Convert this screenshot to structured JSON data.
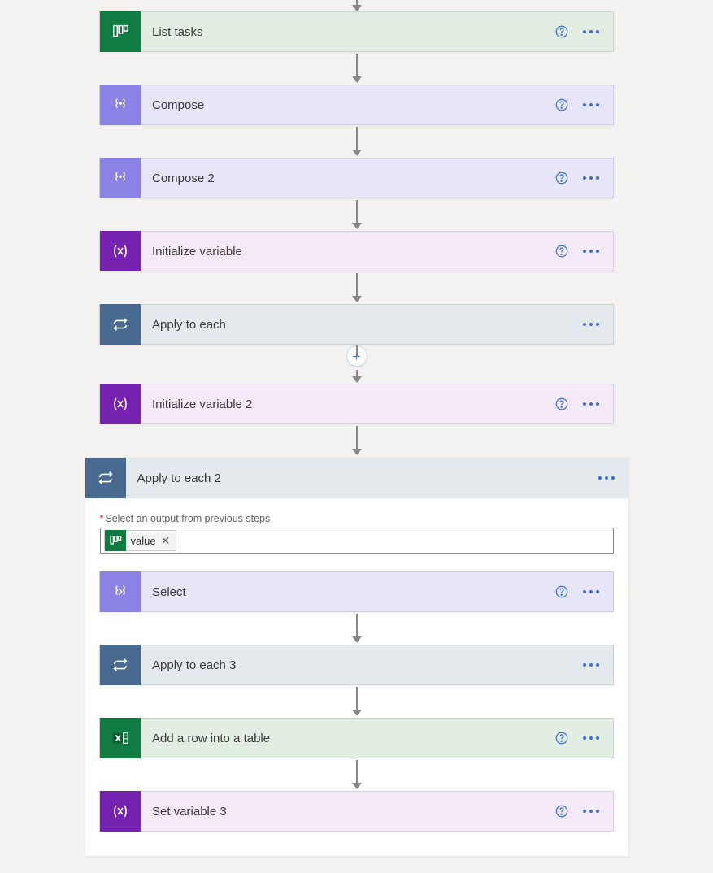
{
  "steps": {
    "list_tasks": "List tasks",
    "compose": "Compose",
    "compose2": "Compose 2",
    "init_var": "Initialize variable",
    "apply_each": "Apply to each",
    "init_var2": "Initialize variable 2",
    "apply_each2": "Apply to each 2",
    "select": "Select",
    "apply_each3": "Apply to each 3",
    "add_row": "Add a row into a table",
    "set_var3": "Set variable 3"
  },
  "panel": {
    "field_label": "Select an output from previous steps",
    "token_label": "value",
    "required_marker": "*"
  },
  "plus": "+"
}
